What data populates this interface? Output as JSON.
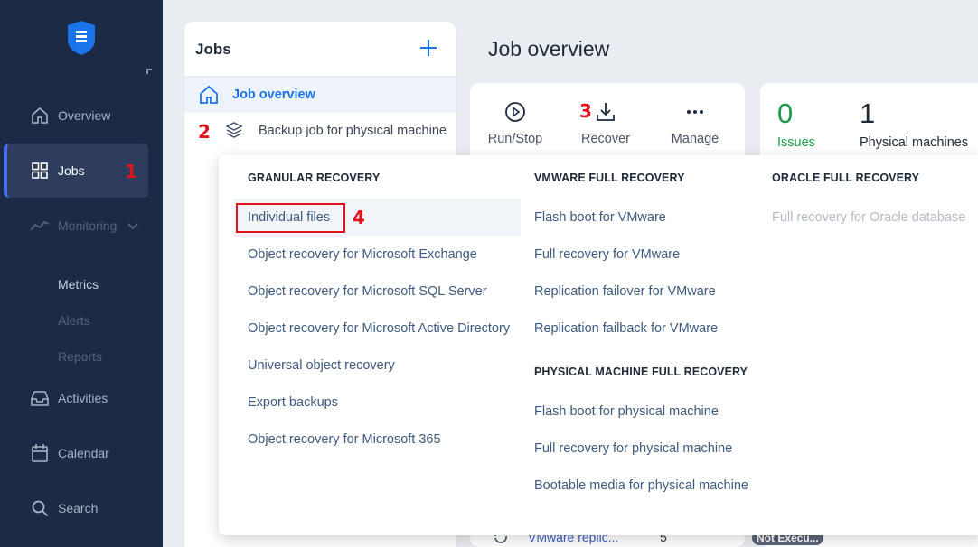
{
  "sidebar": {
    "items": [
      {
        "label": "Overview"
      },
      {
        "label": "Jobs"
      },
      {
        "label": "Monitoring"
      },
      {
        "label": "Activities"
      },
      {
        "label": "Calendar"
      },
      {
        "label": "Search"
      }
    ],
    "monitoring_sub": [
      "Metrics",
      "Alerts",
      "Reports"
    ]
  },
  "annotations": [
    "1",
    "2",
    "3",
    "4"
  ],
  "jobs_panel": {
    "title": "Jobs",
    "items": [
      {
        "label": "Job overview"
      },
      {
        "label": "Backup job for physical machine"
      }
    ]
  },
  "header": {
    "title": "Job overview"
  },
  "actions": [
    {
      "label": "Run/Stop",
      "icon": "play-circle-icon"
    },
    {
      "label": "Recover",
      "icon": "download-icon"
    },
    {
      "label": "Manage",
      "icon": "more-dots-icon"
    }
  ],
  "stats": [
    {
      "value": "0",
      "label": "Issues",
      "color": "#1a9a4a"
    },
    {
      "value": "1",
      "label": "Physical machines",
      "color": "#1f2a37"
    }
  ],
  "table_peek": {
    "name": "VMware replic...",
    "count": "5",
    "status": "Not Execu..."
  },
  "recover_menu": {
    "granular": {
      "heading": "GRANULAR RECOVERY",
      "items": [
        "Individual files",
        "Object recovery for Microsoft Exchange",
        "Object recovery for Microsoft SQL Server",
        "Object recovery for Microsoft Active Directory",
        "Universal object recovery",
        "Export backups",
        "Object recovery for Microsoft 365"
      ]
    },
    "vmware": {
      "heading": "VMWARE FULL RECOVERY",
      "items": [
        "Flash boot for VMware",
        "Full recovery for VMware",
        "Replication failover for VMware",
        "Replication failback for VMware"
      ]
    },
    "physical": {
      "heading": "PHYSICAL MACHINE FULL RECOVERY",
      "items": [
        "Flash boot for physical machine",
        "Full recovery for physical machine",
        "Bootable media for physical machine"
      ]
    },
    "oracle": {
      "heading": "ORACLE FULL RECOVERY",
      "items": [
        "Full recovery for Oracle database"
      ]
    }
  },
  "colors": {
    "sidebar_bg": "#1b2a45",
    "accent": "#4a6cf7",
    "annotation_red": "#e0121b",
    "link": "#3d5a80",
    "brand_blue": "#1a73e8"
  }
}
